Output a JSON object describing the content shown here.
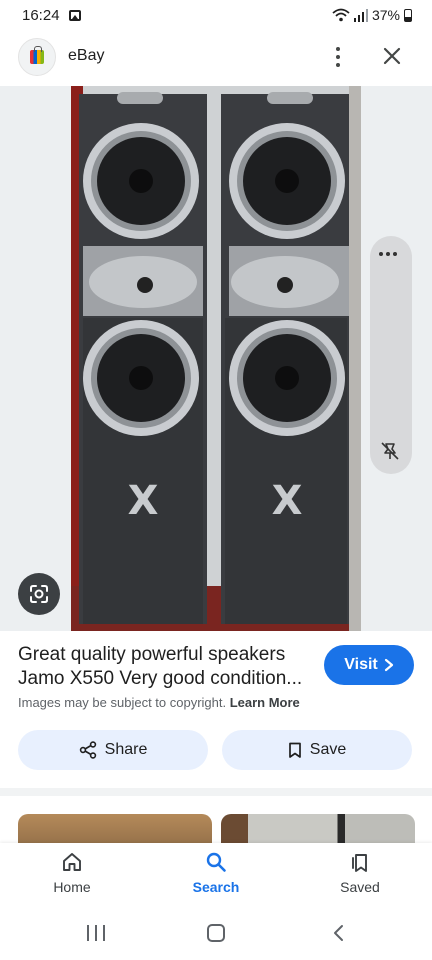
{
  "status_bar": {
    "time": "16:24",
    "battery": "37%",
    "icons": [
      "image-icon",
      "wifi-icon",
      "signal-icon",
      "battery-icon"
    ]
  },
  "app_bar": {
    "site_name": "eBay",
    "icons": [
      "ebay-bag-icon",
      "more-vert-icon",
      "close-icon"
    ]
  },
  "result": {
    "title": "Great quality powerful speakers Jamo X550 Very good condition...",
    "visit_label": "Visit",
    "copyright_prefix": "Images may be subject to copyright. ",
    "learn_more": "Learn More"
  },
  "actions": {
    "share_label": "Share",
    "save_label": "Save"
  },
  "bottom_nav": {
    "items": [
      {
        "label": "Home",
        "icon": "home-icon",
        "active": false
      },
      {
        "label": "Search",
        "icon": "search-icon",
        "active": true
      },
      {
        "label": "Saved",
        "icon": "bookmark-icon",
        "active": false
      }
    ]
  },
  "colors": {
    "accent": "#1a73e8",
    "chip_bg": "#e8f0fe",
    "text_primary": "#1f1f1f",
    "text_secondary": "#5f6368"
  }
}
